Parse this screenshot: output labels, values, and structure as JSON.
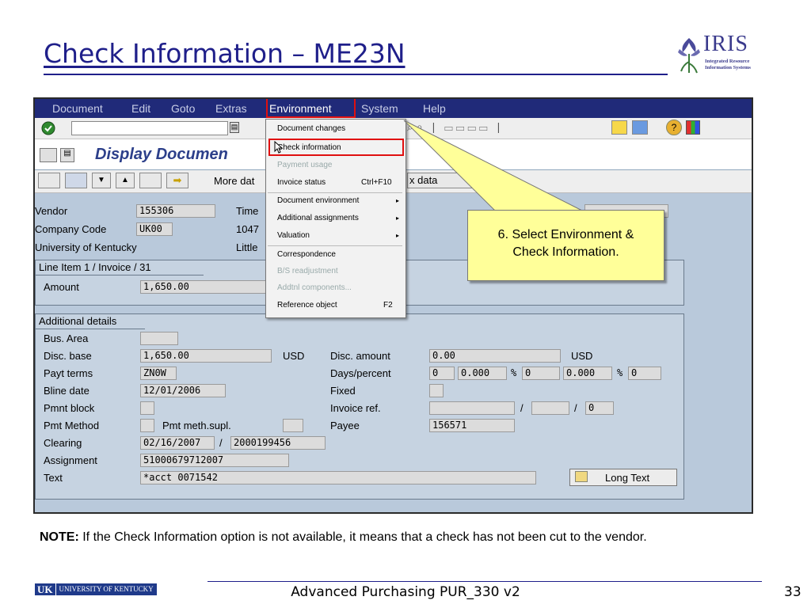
{
  "slide": {
    "title": "Check Information – ME23N",
    "logo_text": "IRIS",
    "logo_subtitle1": "Integrated Resource",
    "logo_subtitle2": "Information Systems",
    "note_bold": "NOTE:",
    "note_text": " If the Check Information option is not available, it means that a check has not been cut to the vendor.",
    "footer_logo": "UK",
    "footer_univ": "UNIVERSITY OF KENTUCKY",
    "footer_center": "Advanced Purchasing PUR_330 v2",
    "page_number": "33"
  },
  "sap": {
    "menu": [
      "Document",
      "Edit",
      "Goto",
      "Extras",
      "Environment",
      "System",
      "Help"
    ],
    "screen_title": "Display Documen",
    "toolbar2": {
      "more_data": "More dat",
      "fax_data": "x data"
    },
    "header": {
      "vendor_label": "Vendor",
      "vendor_value": "155306",
      "time_label": "Time",
      "company_label": "Company Code",
      "company_value": "UK00",
      "company_num": "1047",
      "university": "University of Kentucky",
      "little": "Little"
    },
    "line_item": {
      "tab": "Line Item 1 / Invoice / 31",
      "amount_label": "Amount",
      "amount_value": "1,650.00"
    },
    "additional": {
      "tab": "Additional details",
      "bus_area": "Bus. Area",
      "disc_base_label": "Disc. base",
      "disc_base_value": "1,650.00",
      "disc_base_curr": "USD",
      "disc_amount_label": "Disc. amount",
      "disc_amount_value": "0.00",
      "disc_amount_curr": "USD",
      "payt_terms_label": "Payt terms",
      "payt_terms_value": "ZN0W",
      "days_percent_label": "Days/percent",
      "days1": "0",
      "pct1": "0.000",
      "pct_sign1": "%",
      "days2": "0",
      "pct2": "0.000",
      "pct_sign2": "%",
      "days3": "0",
      "bline_label": "Bline date",
      "bline_value": "12/01/2006",
      "fixed_label": "Fixed",
      "pmnt_block_label": "Pmnt block",
      "invoice_ref_label": "Invoice ref.",
      "inv_sep1": "/",
      "inv_sep2": "/",
      "inv_num": "0",
      "pmt_method_label": "Pmt Method",
      "pmt_supl_label": "Pmt meth.supl.",
      "payee_label": "Payee",
      "payee_value": "156571",
      "clearing_label": "Clearing",
      "clearing_date": "02/16/2007",
      "clearing_sep": "/",
      "clearing_doc": "2000199456",
      "assignment_label": "Assignment",
      "assignment_value": "51000679712007",
      "text_label": "Text",
      "text_value": "*acct 0071542",
      "long_text_button": "Long Text"
    },
    "dropdown": [
      {
        "label": "Document changes",
        "enabled": true
      },
      {
        "label": "Check information",
        "enabled": true
      },
      {
        "label": "Payment usage",
        "enabled": false
      },
      {
        "label": "Invoice status",
        "shortcut": "Ctrl+F10",
        "enabled": true
      },
      {
        "label": "Document environment",
        "submenu": true,
        "enabled": true
      },
      {
        "label": "Additional assignments",
        "submenu": true,
        "enabled": true
      },
      {
        "label": "Valuation",
        "submenu": true,
        "enabled": true
      },
      {
        "label": "Correspondence",
        "enabled": true
      },
      {
        "label": "B/S readjustment",
        "enabled": false
      },
      {
        "label": "Addtnl components...",
        "enabled": false
      },
      {
        "label": "Reference object",
        "shortcut": "F2",
        "enabled": true
      }
    ]
  },
  "callout": {
    "line1": "6. Select Environment &",
    "line2": "Check Information."
  },
  "colors": {
    "title_blue": "#1f1f8a",
    "menubar": "#202a79",
    "highlight_red": "#e01010",
    "callout_yellow": "#ffff99"
  }
}
